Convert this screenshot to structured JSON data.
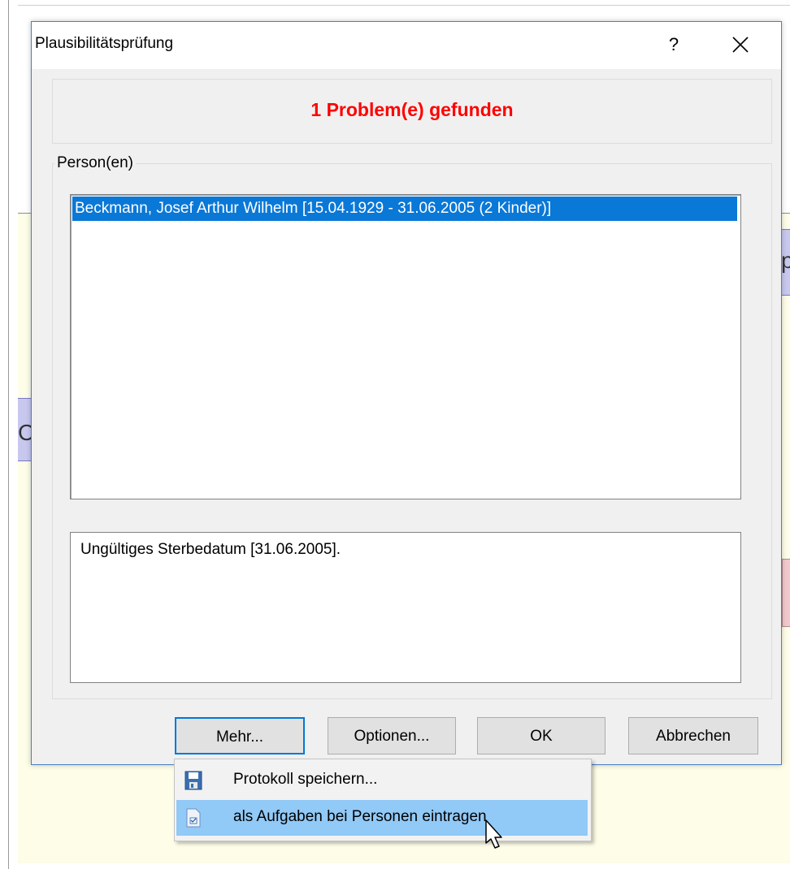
{
  "dialog": {
    "title": "Plausibilitätsprüfung",
    "help_label": "?",
    "close_label": "✕"
  },
  "banner": {
    "text": "1 Problem(e) gefunden",
    "color": "#ff0000"
  },
  "group": {
    "legend": "Person(en)"
  },
  "person_list": {
    "items": [
      {
        "label": "Beckmann, Josef Arthur Wilhelm [15.04.1929 - 31.06.2005 (2 Kinder)]",
        "selected": true
      }
    ]
  },
  "message": {
    "text": "Ungültiges Sterbedatum [31.06.2005]."
  },
  "buttons": {
    "mehr": "Mehr...",
    "optionen": "Optionen...",
    "ok": "OK",
    "abbrechen": "Abbrechen"
  },
  "menu": {
    "items": [
      {
        "label": "Protokoll speichern...",
        "icon": "save-disk-icon",
        "highlighted": false
      },
      {
        "label": "als Aufgaben bei Personen eintragen",
        "icon": "task-document-icon",
        "highlighted": true
      }
    ]
  },
  "colors": {
    "selection": "#0a78d7",
    "menu_highlight": "#91c9f7",
    "default_button_border": "#0078d7"
  }
}
